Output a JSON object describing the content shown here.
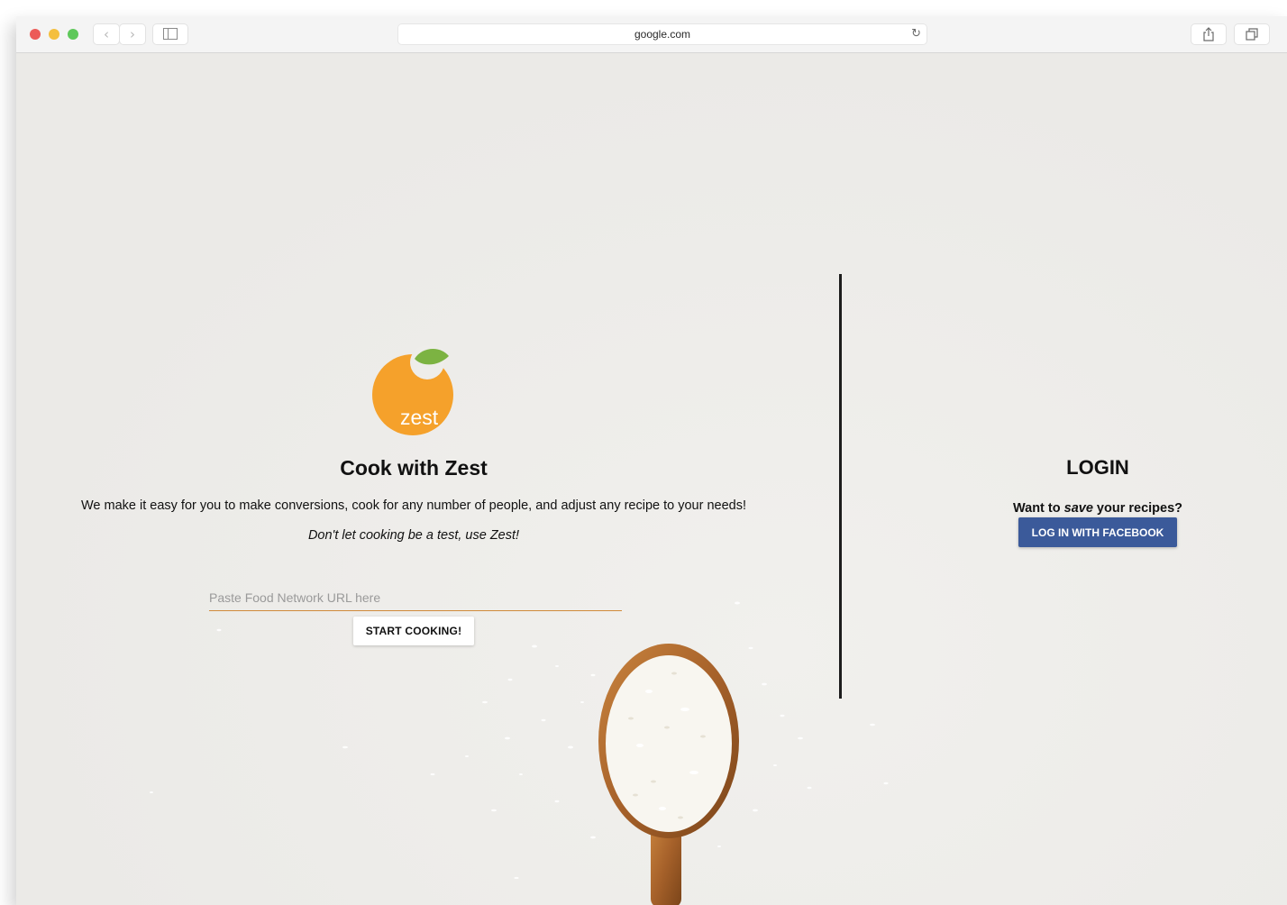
{
  "browser": {
    "url": "google.com",
    "back_glyph": "‹",
    "forward_glyph": "›",
    "reload_glyph": "↻"
  },
  "brand": {
    "logo_text": "zest",
    "logo_colors": {
      "fruit": "#f5a12b",
      "leaf": "#7cb342"
    }
  },
  "hero": {
    "title": "Cook with Zest",
    "subtitle": "We make it easy for you to make conversions, cook for any number of people, and adjust any recipe to your needs!",
    "tagline": "Don't let cooking be a test, use Zest!",
    "url_placeholder": "Paste Food Network URL here",
    "start_label": "START COOKING!"
  },
  "login": {
    "title": "LOGIN",
    "prompt_before": "Want to ",
    "prompt_emphasis": "save",
    "prompt_after": " your recipes?",
    "facebook_label": "LOG IN WITH FACEBOOK",
    "facebook_color": "#3b5a9a"
  },
  "icons": [
    "sidebar-toggle-icon",
    "share-icon",
    "tabs-icon",
    "reload-icon",
    "back-icon",
    "forward-icon"
  ]
}
